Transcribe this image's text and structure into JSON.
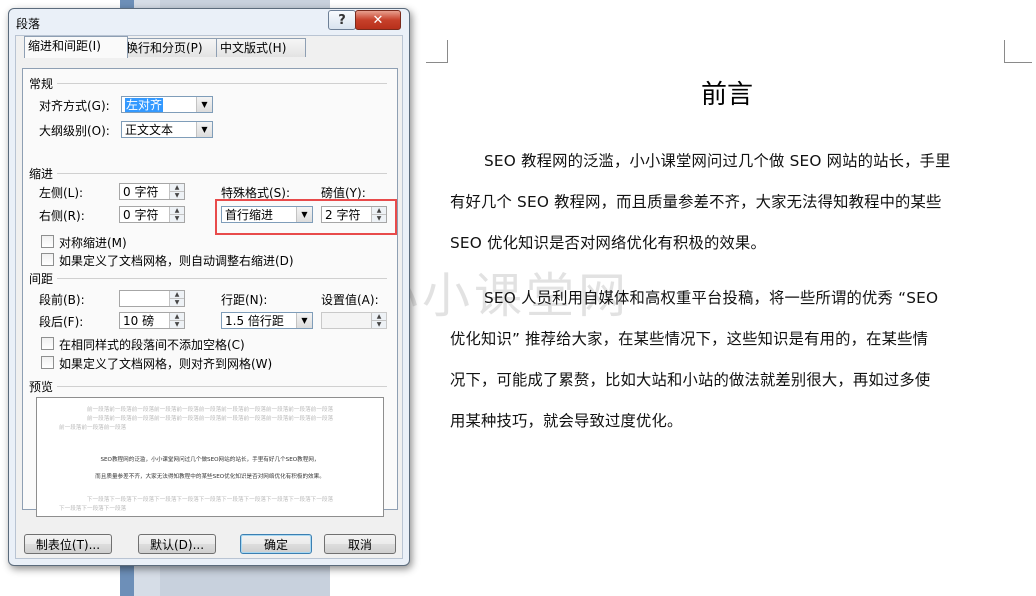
{
  "dialog": {
    "title": "段落",
    "help_label": "?",
    "close_label": "✕",
    "tabs": [
      {
        "label": "缩进和间距(I)"
      },
      {
        "label": "换行和分页(P)"
      },
      {
        "label": "中文版式(H)"
      }
    ],
    "general": {
      "section": "常规",
      "alignment_label": "对齐方式(G):",
      "alignment_value": "左对齐",
      "outline_label": "大纲级别(O):",
      "outline_value": "正文文本"
    },
    "indent": {
      "section": "缩进",
      "left_label": "左侧(L):",
      "left_value": "0 字符",
      "right_label": "右侧(R):",
      "right_value": "0 字符",
      "special_label": "特殊格式(S):",
      "special_value": "首行缩进",
      "by_label": "磅值(Y):",
      "by_value": "2 字符",
      "mirror_label": "对称缩进(M)",
      "auto_adjust_label": "如果定义了文档网格，则自动调整右缩进(D)"
    },
    "spacing": {
      "section": "间距",
      "before_label": "段前(B):",
      "before_value": "",
      "after_label": "段后(F):",
      "after_value": "10 磅",
      "line_label": "行距(N):",
      "line_value": "1.5 倍行距",
      "at_label": "设置值(A):",
      "at_value": "",
      "no_space_label": "在相同样式的段落间不添加空格(C)",
      "snap_grid_label": "如果定义了文档网格，则对齐到网格(W)"
    },
    "preview": {
      "section": "预览",
      "prev_line": "前一段落前一段落前一段落前一段落前一段落前一段落前一段落前一段落前一段落前一段落前一段落",
      "prev_short": "前一段落前一段落前一段落",
      "sample_1": "SEO教程网的泛滥，小小课堂网问过几个做SEO网站的站长，手里有好几个SEO教程网，",
      "sample_2": "而且质量参差不齐，大家无法得知教程中的某些SEO优化知识是否对网络优化有积极的效果。",
      "next_line": "下一段落下一段落下一段落下一段落下一段落下一段落下一段落下一段落下一段落下一段落下一段落",
      "next_short": "下一段落下一段落下一段落"
    },
    "buttons": {
      "tabs": "制表位(T)...",
      "default": "默认(D)...",
      "ok": "确定",
      "cancel": "取消"
    }
  },
  "document": {
    "title": "前言",
    "para1_lines": [
      "SEO 教程网的泛滥，小小课堂网问过几个做 SEO 网站的站长，手里",
      "有好几个 SEO 教程网，而且质量参差不齐，大家无法得知教程中的某些",
      "SEO 优化知识是否对网络优化有积极的效果。"
    ],
    "para2_lines": [
      "SEO 人员利用自媒体和高权重平台投稿，将一些所谓的优秀 “SEO",
      "优化知识” 推荐给大家，在某些情况下，这些知识是有用的，在某些情",
      "况下，可能成了累赘，比如大站和小站的做法就差别很大，再如过多使",
      "用某种技巧，就会导致过度优化。"
    ],
    "watermark_text": "小小课堂网"
  },
  "colors": {
    "highlight": "#e84b4b",
    "selection": "#3399ff"
  }
}
